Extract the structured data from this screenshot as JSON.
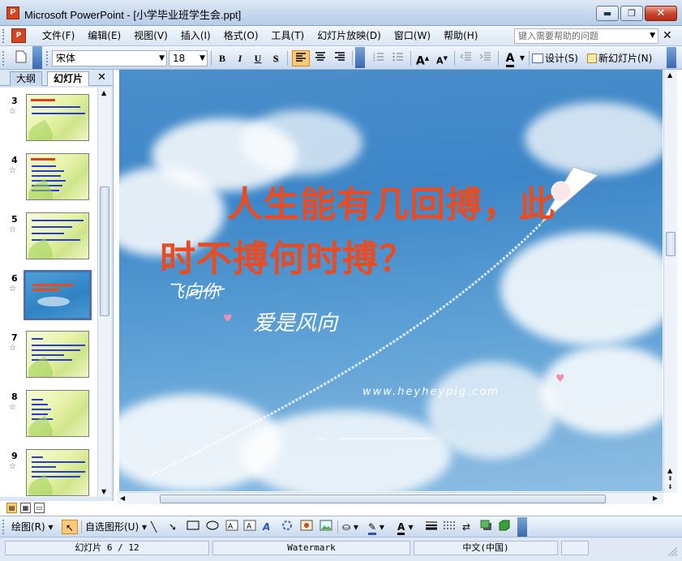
{
  "window": {
    "title": "Microsoft PowerPoint - [小学毕业班学生会.ppt]",
    "app_icon_letter": "P",
    "min_glyph": "▬",
    "max_glyph": "❐",
    "close_glyph": "✕"
  },
  "menu": {
    "items": [
      "文件(F)",
      "编辑(E)",
      "视图(V)",
      "插入(I)",
      "格式(O)",
      "工具(T)",
      "幻灯片放映(D)",
      "窗口(W)",
      "帮助(H)"
    ],
    "help_placeholder": "键入需要帮助的问题",
    "close_glyph": "✕"
  },
  "toolbar": {
    "font_name": "宋体",
    "font_size": "18",
    "bold": "B",
    "italic": "I",
    "underline": "U",
    "shadow": "S",
    "design_label": "设计(S)",
    "new_slide_label": "新幻灯片(N)",
    "font_color_glyph": "A",
    "grow_glyph": "A",
    "shrink_glyph": "A"
  },
  "left_panel": {
    "tab_outline": "大纲",
    "tab_slides": "幻灯片",
    "close_glyph": "✕",
    "slides": [
      {
        "num": "3",
        "selected": false
      },
      {
        "num": "4",
        "selected": false
      },
      {
        "num": "5",
        "selected": false
      },
      {
        "num": "6",
        "selected": true
      },
      {
        "num": "7",
        "selected": false
      },
      {
        "num": "8",
        "selected": false
      },
      {
        "num": "9",
        "selected": false
      }
    ],
    "star_glyph": "☆"
  },
  "slide": {
    "title_line1": "人生能有几回搏，此",
    "title_line2": "时不搏何时搏？",
    "hand_line1": "飞向你",
    "hand_line2": "爱是风向",
    "hand_url": "www.heyheypig.com",
    "heart_glyph": "♥"
  },
  "drawing_toolbar": {
    "draw_label": "绘图(R)",
    "autoshape_label": "自选图形(U)"
  },
  "status": {
    "slide_pos": "幻灯片 6 / 12",
    "template": "Watermark",
    "language": "中文(中国)"
  },
  "colors": {
    "title_red": "#e94c22",
    "selection_orange": "#ffc97a",
    "sky_blue": "#3d86c8"
  }
}
